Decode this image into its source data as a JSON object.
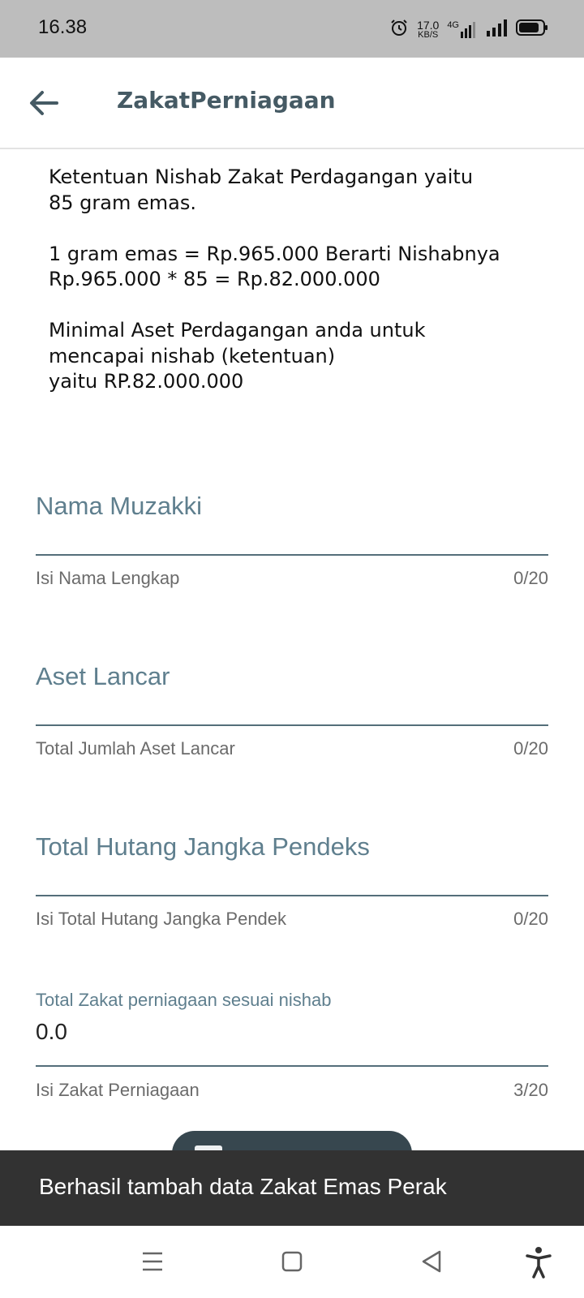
{
  "status_bar": {
    "time": "16.38",
    "net_speed_value": "17.0",
    "net_speed_unit": "KB/S",
    "network_type": "4G"
  },
  "app_bar": {
    "title": "ZakatPerniagaan"
  },
  "info": {
    "text": "Ketentuan Nishab Zakat Perdagangan yaitu\n85 gram emas.\n\n 1 gram emas = Rp.965.000 Berarti Nishabnya\nRp.965.000 * 85 = Rp.82.000.000\n\n Minimal Aset Perdagangan anda untuk\nmencapai nishab (ketentuan)\n yaitu RP.82.000.000"
  },
  "form": {
    "nama": {
      "label": "Nama Muzakki",
      "helper": "Isi Nama Lengkap",
      "counter": "0/20"
    },
    "aset": {
      "label": "Aset Lancar",
      "helper": "Total Jumlah Aset Lancar",
      "counter": "0/20"
    },
    "hutang": {
      "label": "Total Hutang Jangka Pendeks",
      "helper": "Isi Total Hutang Jangka Pendek",
      "counter": "0/20"
    },
    "zakat": {
      "label": "Total Zakat perniagaan sesuai nishab",
      "value": "0.0",
      "helper": "Isi Zakat  Perniagaan",
      "counter": "3/20"
    }
  },
  "snackbar": {
    "message": "Berhasil tambah data Zakat Emas Perak"
  },
  "nav": {
    "icons": [
      "menu-icon",
      "home-square-icon",
      "back-triangle-icon",
      "accessibility-icon"
    ]
  },
  "colors": {
    "status_bar": "#bdbdbd",
    "title": "#455a64",
    "field_label": "#5f7f8e",
    "underline": "#546e7a",
    "snackbar": "#323232",
    "fab": "#37474f"
  }
}
